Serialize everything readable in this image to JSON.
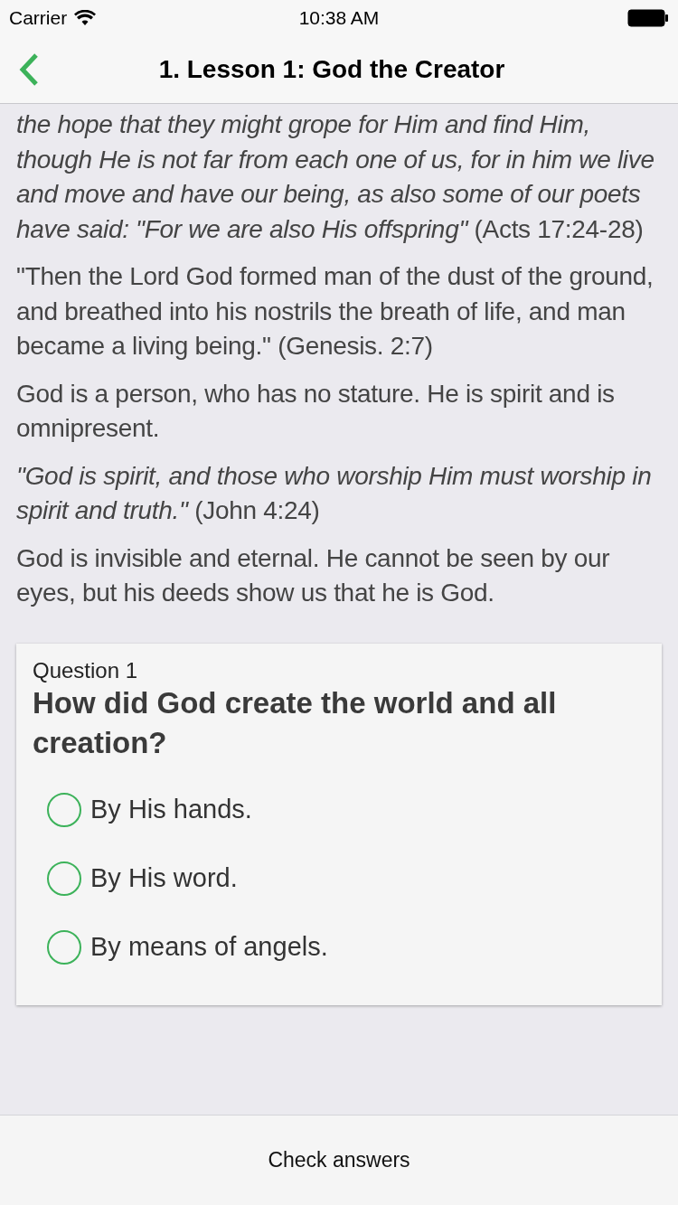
{
  "status_bar": {
    "carrier": "Carrier",
    "time": "10:38 AM"
  },
  "nav": {
    "title": "1. Lesson 1: God the Creator"
  },
  "paragraphs": [
    "*the hope that they might grope for Him and find Him, though He is not far from each one of us, for in him we live and move and have our being, as also some of our poets have said: \"For we are also His offspring\"* (Acts 17:24-28)",
    "\"Then the Lord God formed man of the dust of the ground, and breathed into his nostrils the breath of life, and man became a living being.\" (Genesis. 2:7)",
    "God is a person, who has no stature. He is spirit and is omnipresent.",
    "*\"God is spirit, and those who worship Him must worship in spirit and truth.\"* (John 4:24)",
    "God is invisible and eternal. He cannot be seen by our eyes, but his deeds show us that he is God."
  ],
  "question": {
    "number": "Question 1",
    "text": "How did God create the world and all creation?",
    "options": [
      {
        "label": "By His hands.",
        "selected": false
      },
      {
        "label": "By His word.",
        "selected": false
      },
      {
        "label": "By means of angels.",
        "selected": false
      }
    ]
  },
  "footer": {
    "button": "Check answers"
  }
}
